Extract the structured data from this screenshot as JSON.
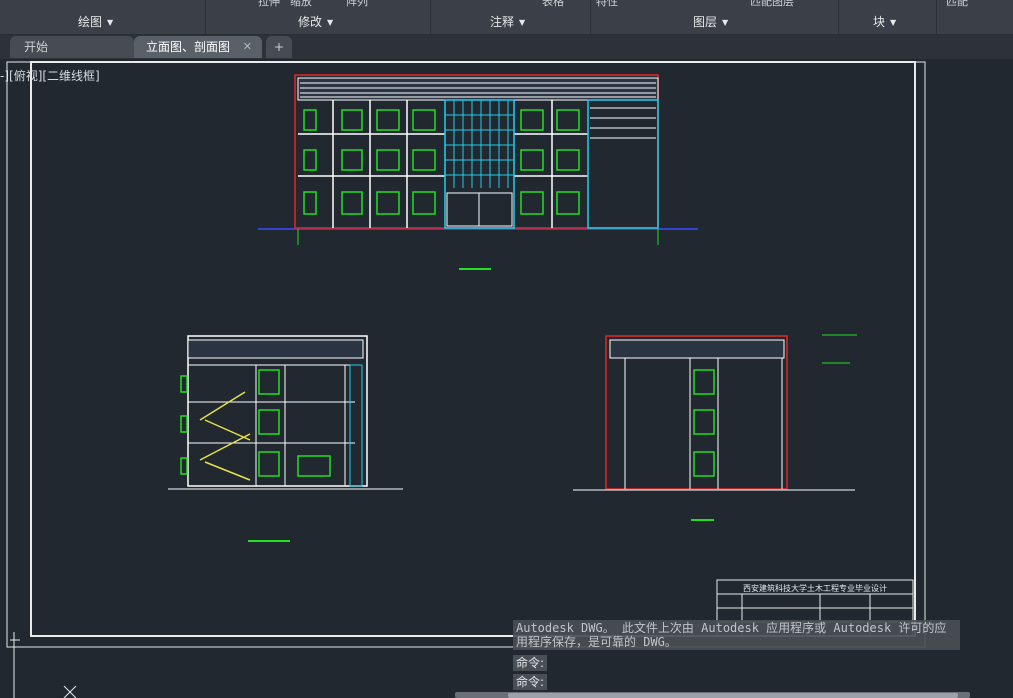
{
  "ribbon": {
    "cut_tools": [
      "拉伸",
      "缩放",
      "阵列",
      "表格",
      "特性",
      "匹配图层",
      "匹配"
    ],
    "panels": [
      "绘图",
      "修改",
      "注释",
      "图层",
      "块"
    ]
  },
  "tabs": {
    "start": "开始",
    "active": "立面图、剖面图",
    "close": "✕",
    "add": "+"
  },
  "viewport": {
    "label": "-][俯视][二维线框]"
  },
  "title_block": {
    "school": "西安建筑科技大学土木工程专业毕业设计"
  },
  "command": {
    "message": "Autodesk DWG。 此文件上次由 Autodesk 应用程序或 Autodesk 许可的应用程序保存，是可靠的 DWG。",
    "prompt1": "命令:",
    "prompt2": "命令:"
  },
  "colors": {
    "background": "#212830",
    "green": "#22dd22",
    "cyan": "#22ccee",
    "red": "#e02828",
    "yellow": "#e6e14a"
  }
}
